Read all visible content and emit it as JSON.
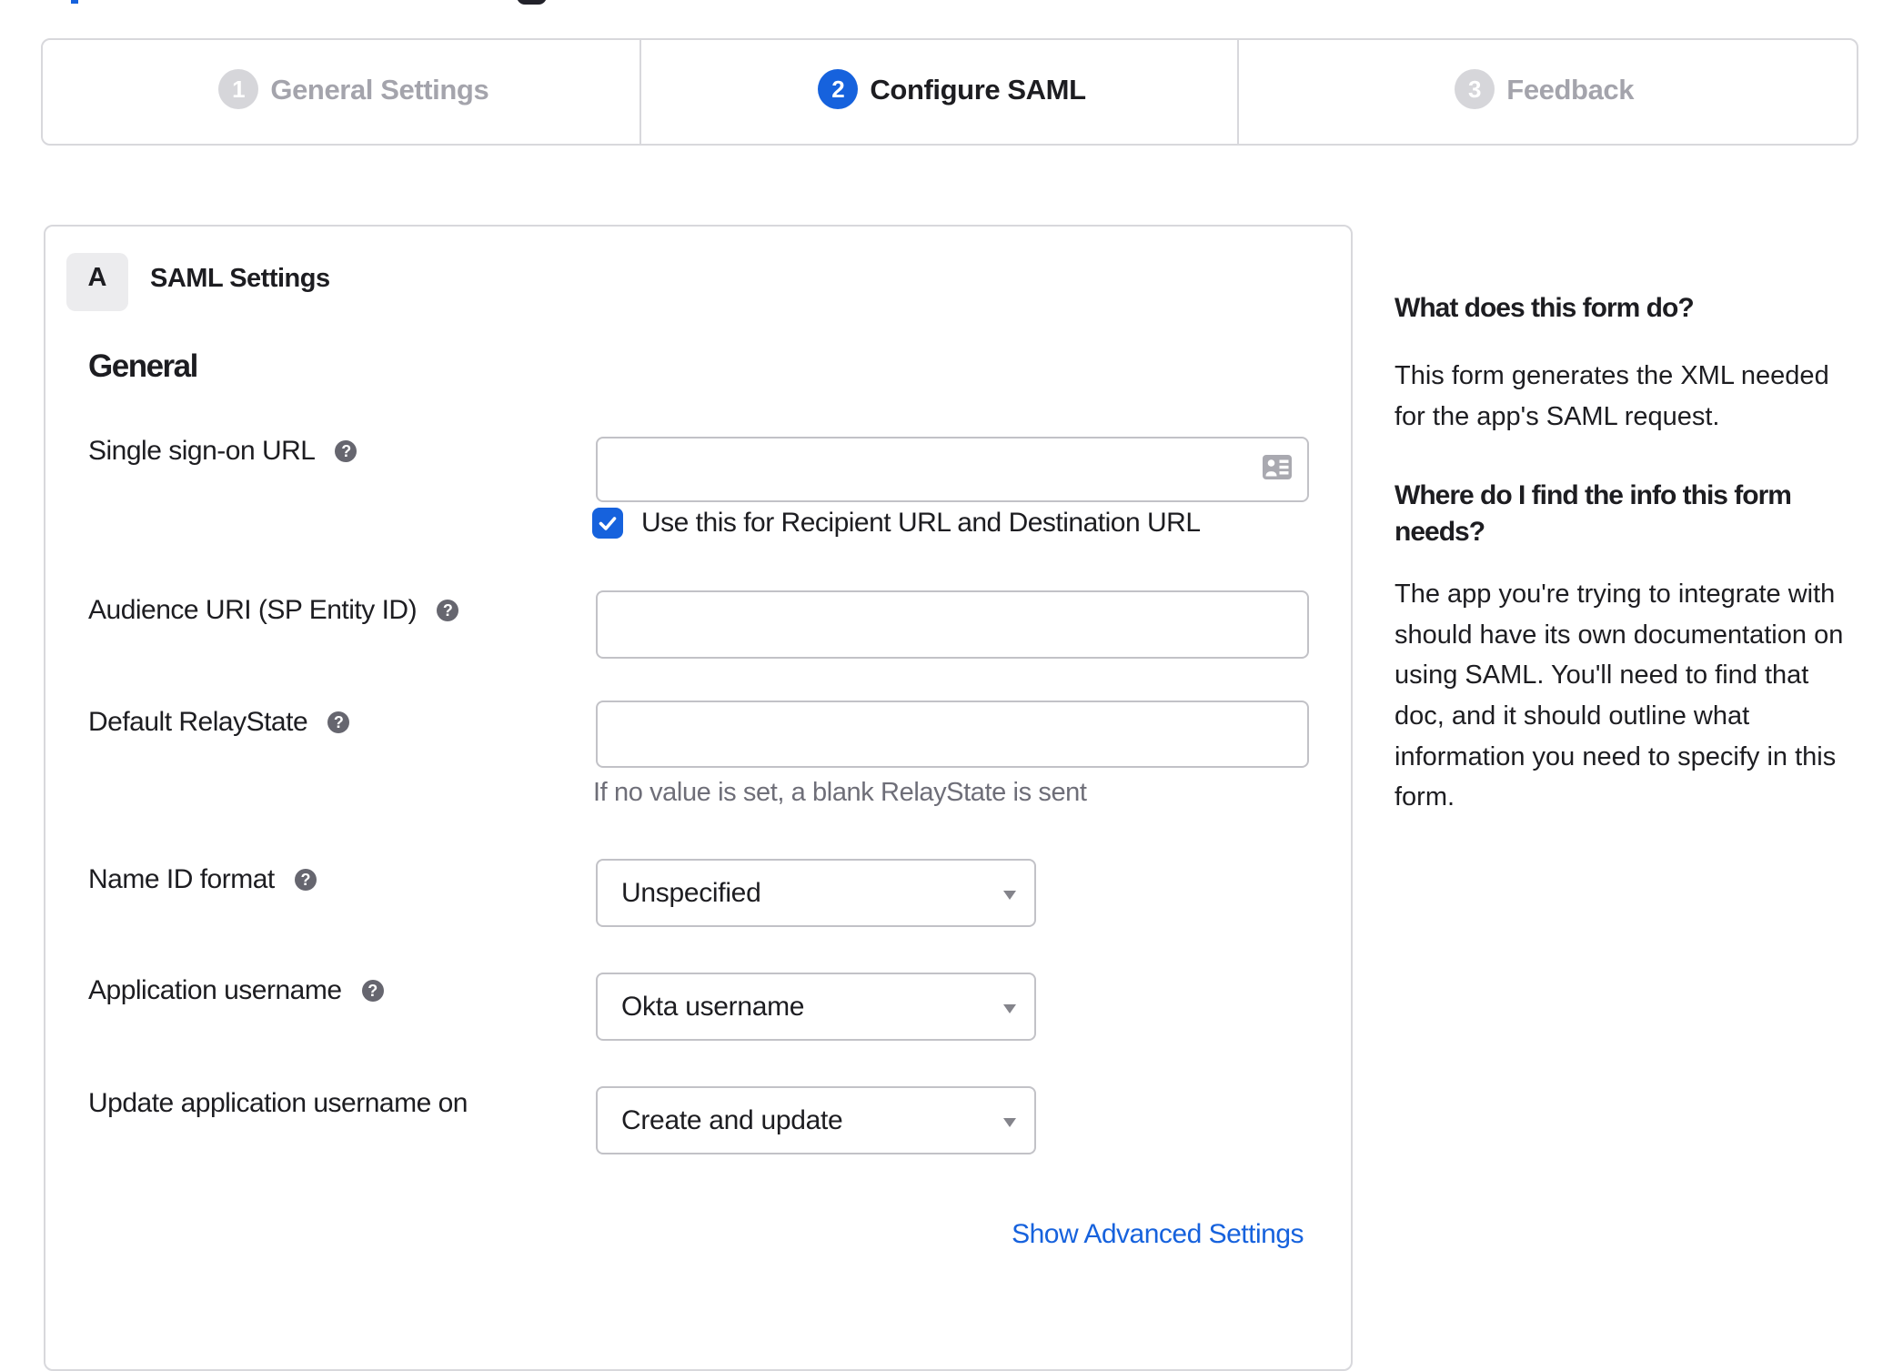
{
  "stepper": {
    "steps": [
      {
        "number": "1",
        "label": "General Settings"
      },
      {
        "number": "2",
        "label": "Configure SAML"
      },
      {
        "number": "3",
        "label": "Feedback"
      }
    ]
  },
  "card": {
    "badge": "A",
    "title": "SAML Settings",
    "group": "General",
    "rows": {
      "sso": {
        "label": "Single sign-on URL",
        "value": "",
        "checkbox_label": "Use this for Recipient URL and Destination URL",
        "checkbox_checked": true
      },
      "audience": {
        "label": "Audience URI (SP Entity ID)",
        "value": ""
      },
      "relaystate": {
        "label": "Default RelayState",
        "value": "",
        "hint": "If no value is set, a blank RelayState is sent"
      },
      "nameid": {
        "label": "Name ID format",
        "value": "Unspecified"
      },
      "appusername": {
        "label": "Application username",
        "value": "Okta username"
      },
      "updateusername": {
        "label": "Update application username on",
        "value": "Create and update"
      }
    },
    "advanced_link": "Show Advanced Settings"
  },
  "help_panel": {
    "sections": [
      {
        "heading": "What does this form do?",
        "body": "This form generates the XML needed\nfor the app's SAML request."
      },
      {
        "heading": "Where do I find the info this form\nneeds?",
        "body": "The app you're trying to integrate with\nshould have its own documentation on\nusing SAML. You'll need to find that\ndoc, and it should outline what\ninformation you need to specify in this\nform."
      }
    ]
  },
  "colors": {
    "primary_blue": "#1662dd",
    "text": "#1d1d21",
    "muted_gray": "#6e6e78",
    "border_light": "#d8d8dc",
    "border_input": "#a9a9b0",
    "step_inactive_text": "#a4a4ac",
    "step_inactive_circle": "#d6d6da",
    "badge_bg": "#ececee"
  }
}
